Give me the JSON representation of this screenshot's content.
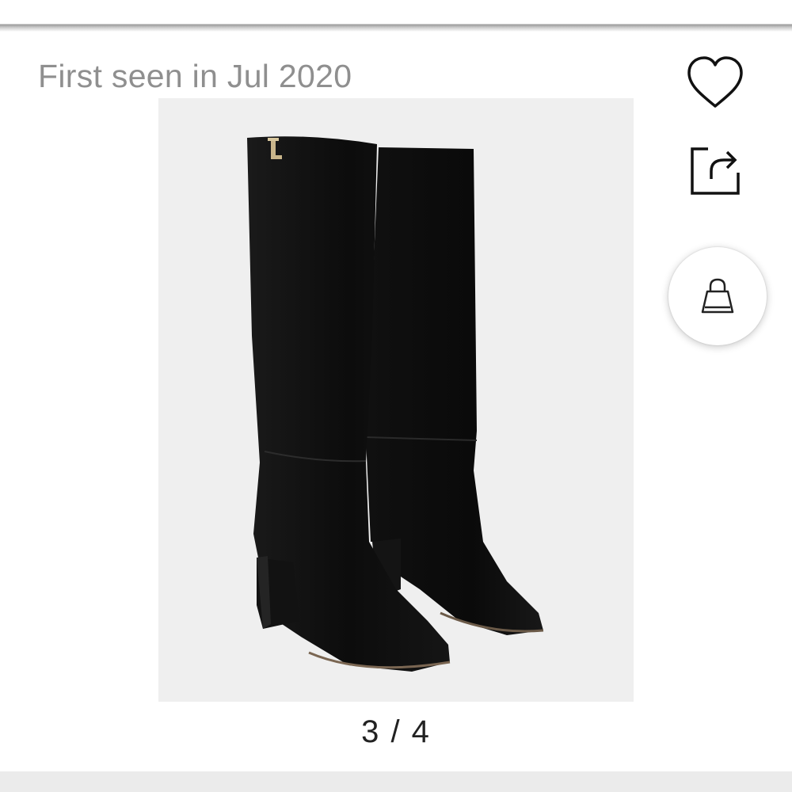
{
  "listing": {
    "first_seen": "First seen in Jul 2020"
  },
  "gallery": {
    "counter": "3 / 4",
    "image_subject": "black leather knee-high boots"
  },
  "actions": {
    "favorite_icon": "heart-icon",
    "share_icon": "share-icon",
    "bag_icon": "shopping-bag-icon"
  },
  "colors": {
    "image_background": "#efefef",
    "muted_text": "#8f8f8f",
    "counter_text": "#222222"
  }
}
